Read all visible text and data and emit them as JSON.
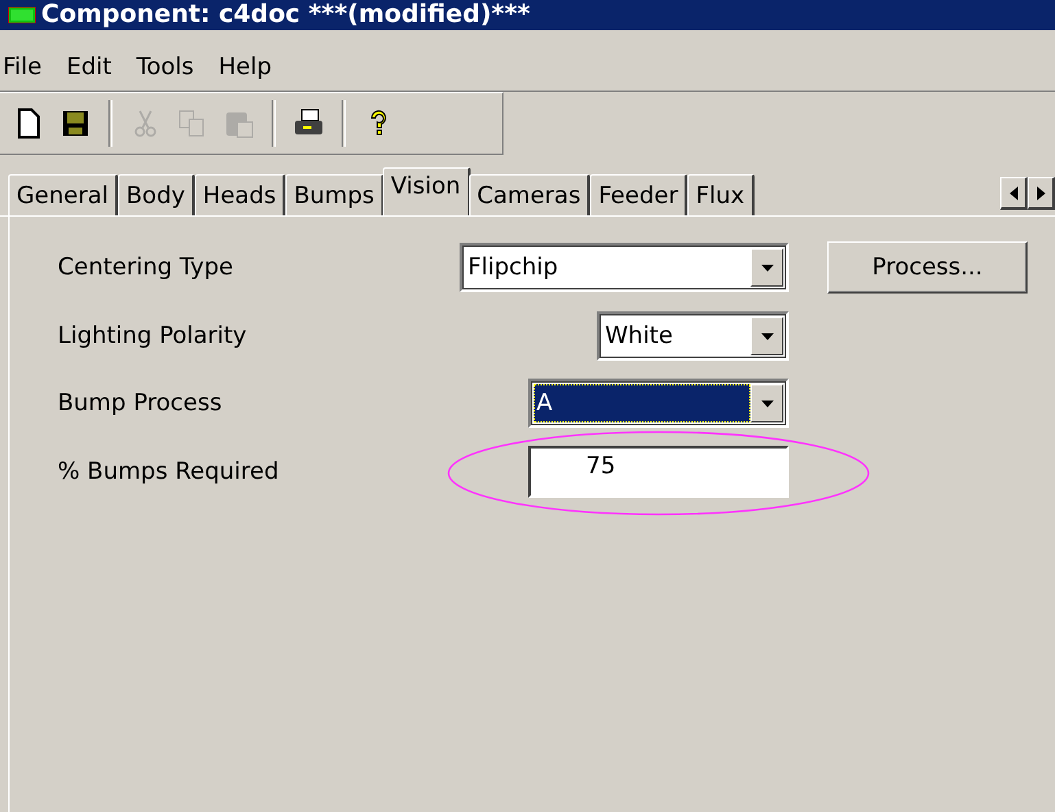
{
  "window": {
    "title": "Component: c4doc ***(modified)***"
  },
  "menu": [
    "File",
    "Edit",
    "Tools",
    "Help"
  ],
  "toolbar": [
    {
      "kind": "new",
      "disabled": false
    },
    {
      "kind": "save",
      "disabled": false
    },
    {
      "kind": "sep"
    },
    {
      "kind": "cut",
      "disabled": true
    },
    {
      "kind": "copy",
      "disabled": true
    },
    {
      "kind": "paste",
      "disabled": true
    },
    {
      "kind": "sep"
    },
    {
      "kind": "print",
      "disabled": false
    },
    {
      "kind": "sep"
    },
    {
      "kind": "help",
      "disabled": false
    }
  ],
  "tabs": [
    {
      "label": "General",
      "selected": false
    },
    {
      "label": "Body",
      "selected": false
    },
    {
      "label": "Heads",
      "selected": false
    },
    {
      "label": "Bumps",
      "selected": false
    },
    {
      "label": "Vision",
      "selected": true
    },
    {
      "label": "Cameras",
      "selected": false
    },
    {
      "label": "Feeder",
      "selected": false
    },
    {
      "label": "Flux",
      "selected": false
    }
  ],
  "fields": [
    {
      "label": "Centering Type",
      "kind": "combo",
      "value": "Flipchip",
      "focused": false,
      "highlighted": false
    },
    {
      "label": "Lighting Polarity",
      "kind": "combo",
      "value": "White",
      "focused": false,
      "highlighted": false
    },
    {
      "label": "Bump Process",
      "kind": "combo",
      "value": "A",
      "focused": true,
      "highlighted": false
    },
    {
      "label": "% Bumps Required",
      "kind": "text",
      "value": "75",
      "focused": false,
      "highlighted": true
    }
  ],
  "process_button": "Process..."
}
